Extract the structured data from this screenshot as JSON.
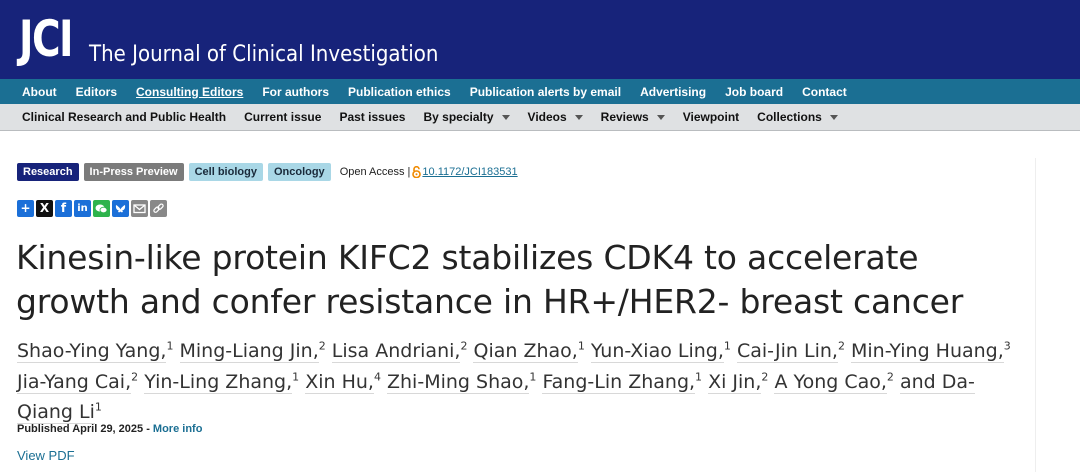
{
  "header": {
    "logo_mark": "JCI",
    "logo_text": "The Journal of Clinical Investigation"
  },
  "nav_top": [
    "About",
    "Editors",
    "Consulting Editors",
    "For authors",
    "Publication ethics",
    "Publication alerts by email",
    "Advertising",
    "Job board",
    "Contact"
  ],
  "nav_sub": {
    "items": [
      "Clinical Research and Public Health",
      "Current issue",
      "Past issues",
      "By specialty",
      "Videos",
      "Reviews",
      "Viewpoint",
      "Collections"
    ]
  },
  "badges": {
    "research": "Research",
    "in_press": "In-Press Preview",
    "topic1": "Cell biology",
    "topic2": "Oncology"
  },
  "access": {
    "label": "Open Access |",
    "doi": "10.1172/JCI183531"
  },
  "share_icons": [
    "plus-icon",
    "x-icon",
    "facebook-icon",
    "linkedin-icon",
    "wechat-icon",
    "bluesky-icon",
    "email-icon",
    "link-icon"
  ],
  "article": {
    "title": "Kinesin-like protein KIFC2 stabilizes CDK4 to accelerate growth and confer resistance in HR+/HER2- breast cancer",
    "authors": [
      {
        "name": "Shao-Ying Yang,",
        "aff": "1"
      },
      {
        "name": "Ming-Liang Jin,",
        "aff": "2"
      },
      {
        "name": "Lisa Andriani,",
        "aff": "2"
      },
      {
        "name": "Qian Zhao,",
        "aff": "1"
      },
      {
        "name": "Yun-Xiao Ling,",
        "aff": "1"
      },
      {
        "name": "Cai-Jin Lin,",
        "aff": "2"
      },
      {
        "name": "Min-Ying Huang,",
        "aff": "3"
      },
      {
        "name": "Jia-Yang Cai,",
        "aff": "2"
      },
      {
        "name": "Yin-Ling Zhang,",
        "aff": "1"
      },
      {
        "name": "Xin Hu,",
        "aff": "4"
      },
      {
        "name": "Zhi-Ming Shao,",
        "aff": "1"
      },
      {
        "name": "Fang-Lin Zhang,",
        "aff": "1"
      },
      {
        "name": "Xi Jin,",
        "aff": "2"
      },
      {
        "name": "A Yong Cao,",
        "aff": "2"
      },
      {
        "name": "and Da-Qiang Li",
        "aff": "1"
      }
    ],
    "published": "Published April 29, 2025 -",
    "more_info": "More info",
    "view_pdf": "View PDF"
  },
  "colors": {
    "masthead": "#17237a",
    "nav_top": "#1b6f93",
    "nav_sub": "#dfe1e3",
    "badge_topic": "#a9d7e6",
    "link": "#1b6f93"
  }
}
